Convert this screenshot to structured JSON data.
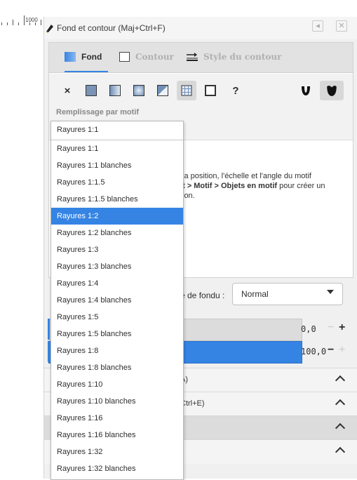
{
  "ruler": {
    "label": "1000"
  },
  "dialog": {
    "title": "Fond et contour (Maj+Ctrl+F)",
    "tabs": [
      {
        "label": "Fond"
      },
      {
        "label": "Contour"
      },
      {
        "label": "Style du contour"
      }
    ],
    "fill_buttons": [
      "no-paint",
      "flat-color",
      "linear-gradient",
      "radial-gradient",
      "mesh-gradient",
      "pattern",
      "swatch",
      "unset"
    ],
    "fill_unset_label": "?",
    "mode_label": "Remplissage par motif",
    "info_text_1": "la position, l'échelle et l'angle du motif",
    "info_text_2a": "t > Motif > Objets en motif",
    "info_text_2b": " pour créer un",
    "info_text_3": "ion.",
    "blend_label": "e de fondu :",
    "blend_value": "Normal",
    "blur_value": "0,0",
    "opacity_value": "100,0",
    "sections": [
      {
        "label": "A)"
      },
      {
        "label": "Ctrl+E)"
      },
      {
        "label": ""
      },
      {
        "label": ""
      }
    ]
  },
  "pattern_dropdown": {
    "current": "Rayures 1:1",
    "items": [
      "Rayures 1:1",
      "Rayures 1:1 blanches",
      "Rayures 1:1.5",
      "Rayures 1:1.5 blanches",
      "Rayures 1:2",
      "Rayures 1:2 blanches",
      "Rayures 1:3",
      "Rayures 1:3 blanches",
      "Rayures 1:4",
      "Rayures 1:4 blanches",
      "Rayures 1:5",
      "Rayures 1:5 blanches",
      "Rayures 1:8",
      "Rayures 1:8 blanches",
      "Rayures 1:10",
      "Rayures 1:10 blanches",
      "Rayures 1:16",
      "Rayures 1:16 blanches",
      "Rayures 1:32",
      "Rayures 1:32 blanches"
    ],
    "selected_index": 4
  },
  "colors": {
    "accent": "#3584e4"
  }
}
